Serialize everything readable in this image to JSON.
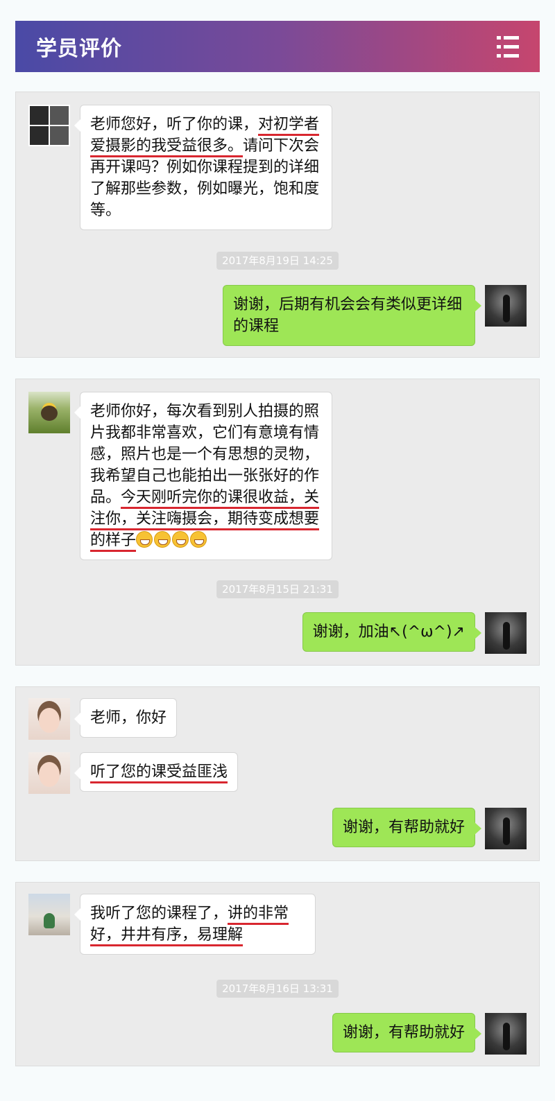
{
  "header": {
    "title": "学员评价",
    "menu_icon": "list-menu-icon"
  },
  "panels": [
    {
      "messages": [
        {
          "side": "left",
          "avatar": "grid-photo-avatar",
          "parts": [
            "老师您好，听了你的课，",
            "对初学者爱摄影的我受益很多。",
            "请问下次会再开课吗？例如你课程提到的详细了解那些参数，例如曝光，饱和度等。"
          ]
        },
        {
          "side": "time",
          "text": "2017年8月19日 14:25"
        },
        {
          "side": "right",
          "avatar": "teacher-avatar",
          "text": "谢谢，后期有机会会有类似更详细的课程"
        }
      ]
    },
    {
      "messages": [
        {
          "side": "left",
          "avatar": "flower-girl-avatar",
          "parts": [
            "老师你好，每次看到别人拍摄的照片我都非常喜欢，它们有意境有情感，照片也是一个有思想的灵物，我希望自己也能拍出一张张好的作品。",
            "今天刚听完你的课很收益，关注你，关注嗨摄会，期待变成想要的样子"
          ]
        },
        {
          "side": "time",
          "text": "2017年8月15日 21:31"
        },
        {
          "side": "right",
          "avatar": "teacher-avatar",
          "text": "谢谢，加油↖(^ω^)↗"
        }
      ]
    },
    {
      "messages": [
        {
          "side": "left",
          "avatar": "cat-filter-girl-avatar",
          "text": "老师，你好"
        },
        {
          "side": "left",
          "avatar": "cat-filter-girl-avatar",
          "text": "听了您的课受益匪浅"
        },
        {
          "side": "right",
          "avatar": "teacher-avatar",
          "text": "谢谢，有帮助就好"
        }
      ]
    },
    {
      "messages": [
        {
          "side": "left",
          "avatar": "road-avatar",
          "parts": [
            "我听了您的课程了，",
            "讲的非常好，井井有序，易理解"
          ]
        },
        {
          "side": "time",
          "text": "2017年8月16日 13:31"
        },
        {
          "side": "right",
          "avatar": "teacher-avatar",
          "text": "谢谢，有帮助就好"
        }
      ]
    }
  ]
}
